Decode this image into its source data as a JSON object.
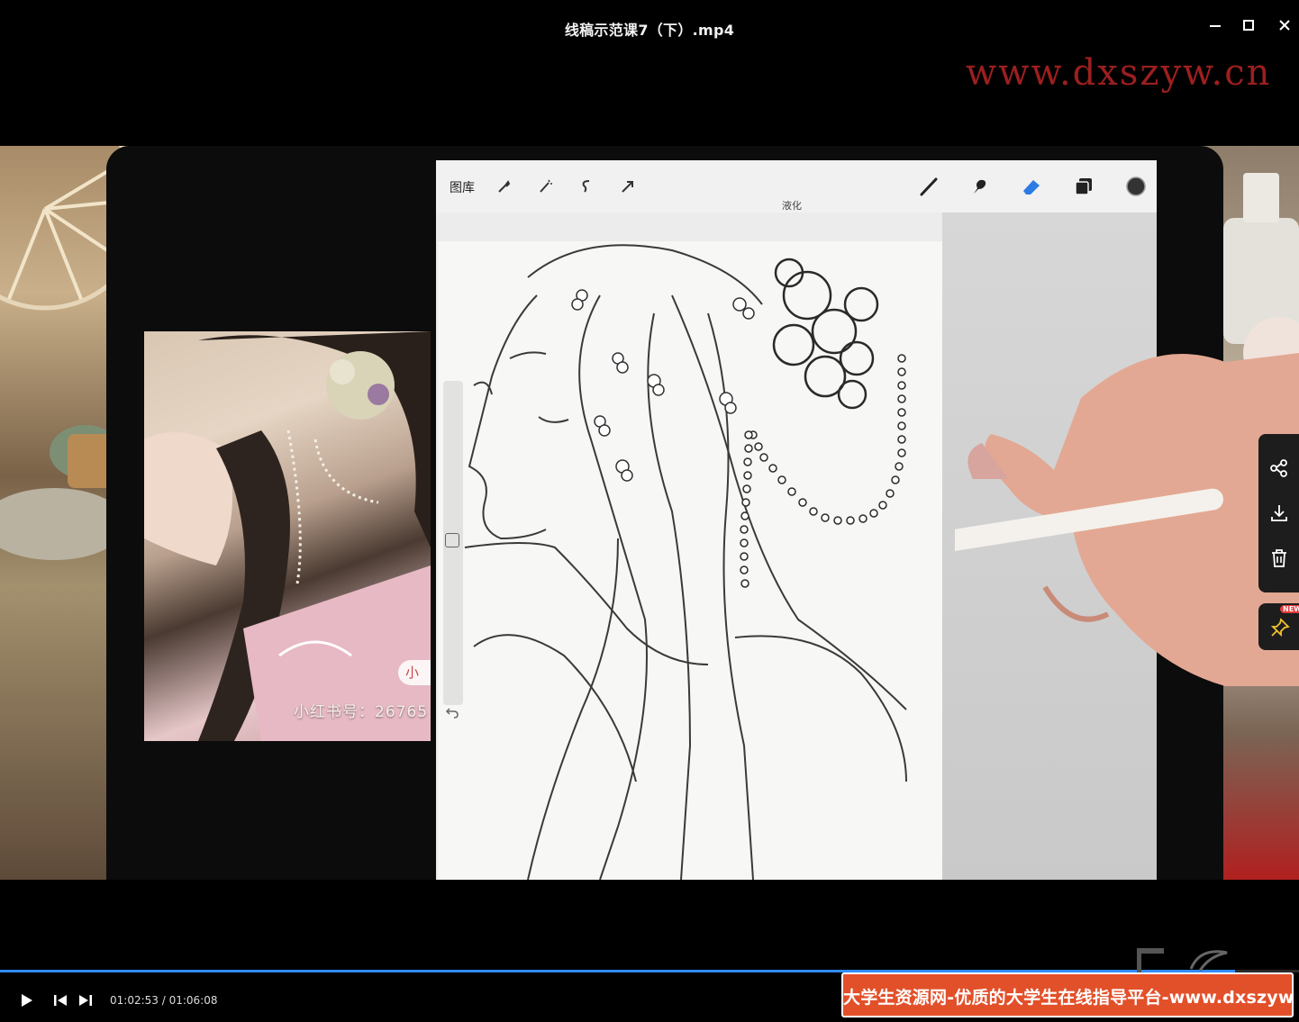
{
  "window": {
    "title": "线稿示范课7（下）.mp4",
    "controls": [
      "minimize-icon",
      "maximize-icon",
      "close-icon"
    ]
  },
  "watermark_top": "www.dxszyw.cn",
  "video": {
    "procreate": {
      "gallery_label": "图库",
      "tools_left": [
        "wrench-icon",
        "magic-wand-icon",
        "selection-icon",
        "transform-arrow-icon"
      ],
      "tools_right": [
        "brush-icon",
        "smudge-icon",
        "eraser-icon",
        "layers-icon",
        "color-swatch"
      ],
      "active_tool_label": "液化"
    },
    "reference_photo": {
      "caption": "小红书号：26765",
      "badge": "小"
    }
  },
  "float_panel": {
    "items": [
      "share-icon",
      "download-icon",
      "delete-icon"
    ],
    "pin": {
      "icon": "pin-icon",
      "badge": "NEW"
    }
  },
  "player": {
    "current_time": "01:02:53",
    "duration": "01:06:08",
    "time_display": "01:02:53 / 01:06:08",
    "progress": 0.951
  },
  "banner": {
    "text": "大学生资源网-优质的大学生在线指导平台-www.dxszyw.cn"
  },
  "colors": {
    "accent_progress": "#2f8cff",
    "banner_bg": "#e2502a",
    "watermark": "#9c1f1f"
  }
}
